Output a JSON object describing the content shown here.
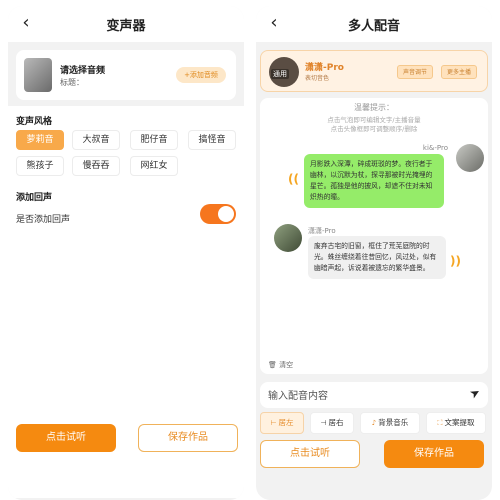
{
  "left": {
    "title": "变声器",
    "audio": {
      "main": "请选择音频",
      "sub": "标题：",
      "add_label": "+添加音频"
    },
    "style_title": "变声风格",
    "styles": [
      "萝莉音",
      "大叔音",
      "肥仔音",
      "搞怪音",
      "熊孩子",
      "慢吞吞",
      "网红女"
    ],
    "active_style_index": 0,
    "echo_title": "添加回声",
    "echo_label": "是否添加回声",
    "echo_on": true,
    "listen_label": "点击试听",
    "save_label": "保存作品"
  },
  "right": {
    "title": "多人配音",
    "top": {
      "badge": "通用",
      "name": "潇潇-Pro",
      "sub": "表切音色",
      "btn1": "声音调节",
      "btn2": "更多主播"
    },
    "tips": {
      "title": "温馨提示：",
      "line1": "点击气泡即可编辑文字/主播音量",
      "line2": "点击头像框即可调整顺序/删除"
    },
    "messages": [
      {
        "speaker": "ki&-Pro",
        "text": "月影跌入深潭，碎成斑驳的梦。夜行者于幽林，以沉默为杖，探寻那被时光掩埋的星芒。孤独是他的披风，却遮不住对未知炽热的瞳。"
      },
      {
        "speaker": "潇潇-Pro",
        "text": "废弃古宅的旧窗，框住了荒芜庭院的时光。蛛丝缠绕着往昔回忆，风过处，似有幽暗声起，诉说着被遗忘的繁华盛景。"
      }
    ],
    "clear_label": "清空",
    "input_placeholder": "输入配音内容",
    "tools": [
      {
        "label": "居左",
        "icon": "align-left-icon"
      },
      {
        "label": "居右",
        "icon": "align-right-icon"
      },
      {
        "label": "背景音乐",
        "icon": "music-icon"
      },
      {
        "label": "文案提取",
        "icon": "scan-icon"
      }
    ],
    "listen_label": "点击试听",
    "save_label": "保存作品"
  },
  "colors": {
    "accent": "#f58a10",
    "bubble_green": "#95ec69",
    "toggle_on": "#f6761e"
  }
}
